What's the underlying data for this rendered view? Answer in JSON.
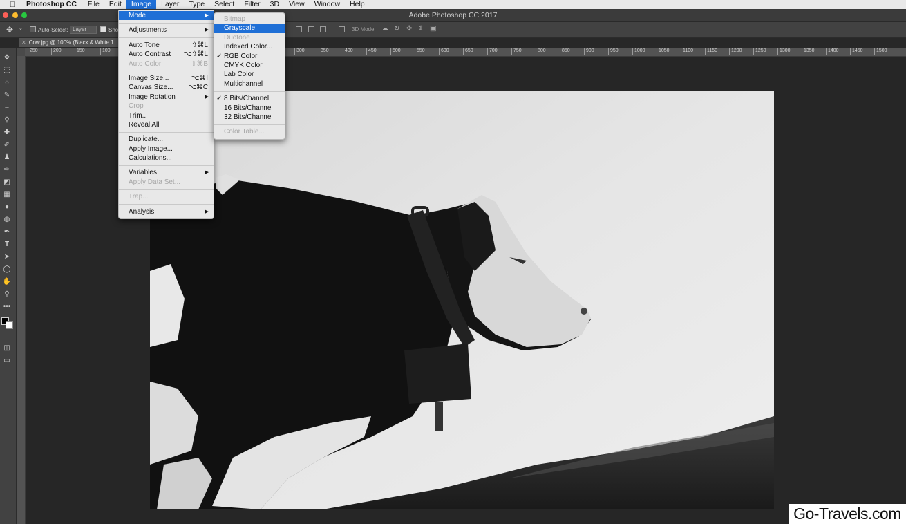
{
  "menubar": {
    "app_name": "Photoshop CC",
    "items": [
      "File",
      "Edit",
      "Image",
      "Layer",
      "Type",
      "Select",
      "Filter",
      "3D",
      "View",
      "Window",
      "Help"
    ],
    "active_item": "Image"
  },
  "window": {
    "title": "Adobe Photoshop CC 2017"
  },
  "options_bar": {
    "auto_select_label": "Auto-Select:",
    "auto_select_value": "Layer",
    "show_label": "Show",
    "mode_3d_label": "3D Mode:"
  },
  "document": {
    "tab_title": "Cow.jpg @ 100% (Black & White 1"
  },
  "ruler": {
    "h_ticks": [
      "250",
      "200",
      "150",
      "100",
      "300",
      "350",
      "400",
      "450",
      "500",
      "550",
      "600",
      "650",
      "700",
      "750",
      "800",
      "850",
      "900",
      "950",
      "1000",
      "1050",
      "1100",
      "1150",
      "1200",
      "1250",
      "1300",
      "1350",
      "1400",
      "1450",
      "1500"
    ]
  },
  "image_menu": {
    "items": [
      {
        "label": "Mode",
        "submenu": true,
        "highlighted": true
      },
      {
        "sep": true
      },
      {
        "label": "Adjustments",
        "submenu": true
      },
      {
        "sep": true
      },
      {
        "label": "Auto Tone",
        "shortcut": "⇧⌘L"
      },
      {
        "label": "Auto Contrast",
        "shortcut": "⌥⇧⌘L"
      },
      {
        "label": "Auto Color",
        "shortcut": "⇧⌘B",
        "disabled": true
      },
      {
        "sep": true
      },
      {
        "label": "Image Size...",
        "shortcut": "⌥⌘I"
      },
      {
        "label": "Canvas Size...",
        "shortcut": "⌥⌘C"
      },
      {
        "label": "Image Rotation",
        "submenu": true
      },
      {
        "label": "Crop",
        "disabled": true
      },
      {
        "label": "Trim..."
      },
      {
        "label": "Reveal All"
      },
      {
        "sep": true
      },
      {
        "label": "Duplicate..."
      },
      {
        "label": "Apply Image..."
      },
      {
        "label": "Calculations..."
      },
      {
        "sep": true
      },
      {
        "label": "Variables",
        "submenu": true
      },
      {
        "label": "Apply Data Set...",
        "disabled": true
      },
      {
        "sep": true
      },
      {
        "label": "Trap...",
        "disabled": true
      },
      {
        "sep": true
      },
      {
        "label": "Analysis",
        "submenu": true
      }
    ]
  },
  "mode_submenu": {
    "items": [
      {
        "label": "Bitmap",
        "disabled": true
      },
      {
        "label": "Grayscale",
        "highlighted": true
      },
      {
        "label": "Duotone",
        "disabled": true
      },
      {
        "label": "Indexed Color..."
      },
      {
        "label": "RGB Color",
        "checked": true
      },
      {
        "label": "CMYK Color"
      },
      {
        "label": "Lab Color"
      },
      {
        "label": "Multichannel"
      },
      {
        "sep": true
      },
      {
        "label": "8 Bits/Channel",
        "checked": true
      },
      {
        "label": "16 Bits/Channel"
      },
      {
        "label": "32 Bits/Channel"
      },
      {
        "sep": true
      },
      {
        "label": "Color Table...",
        "disabled": true
      }
    ]
  },
  "watermark": {
    "text": "Go-Travels.com"
  },
  "colors": {
    "menu_highlight": "#1f6fd6",
    "menu_bg": "#e8e8e8",
    "panel_bg": "#424242",
    "canvas_bg": "#262626"
  }
}
